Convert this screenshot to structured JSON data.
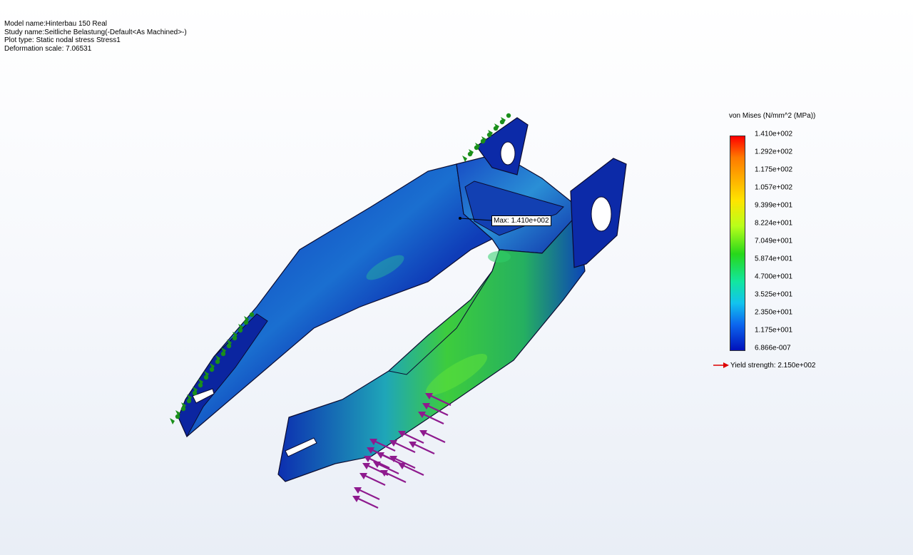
{
  "study_info": {
    "model_name": "Model name:Hinterbau 150 Real",
    "study_name": "Study name:Seitliche Belastung(-Default<As Machined>-)",
    "plot_type": "Plot type: Static nodal stress Stress1",
    "deformation_scale": "Deformation scale: 7.06531"
  },
  "legend": {
    "title": "von Mises (N/mm^2 (MPa))",
    "ticks": [
      "1.410e+002",
      "1.292e+002",
      "1.175e+002",
      "1.057e+002",
      "9.399e+001",
      "8.224e+001",
      "7.049e+001",
      "5.874e+001",
      "4.700e+001",
      "3.525e+001",
      "2.350e+001",
      "1.175e+001",
      "6.866e-007"
    ],
    "yield_strength": "Yield strength: 2.150e+002",
    "colors": {
      "max": "#ff0000",
      "min": "#0011bb",
      "yield_arrow": "#dd0000"
    }
  },
  "max_probe": {
    "label": "Max: 1.410e+002"
  },
  "colors": {
    "fixture": "#1a8f1a",
    "load_arrow": "#8e1a8e",
    "part_base": "#0a1ea8",
    "part_edge": "#0b0b30"
  }
}
